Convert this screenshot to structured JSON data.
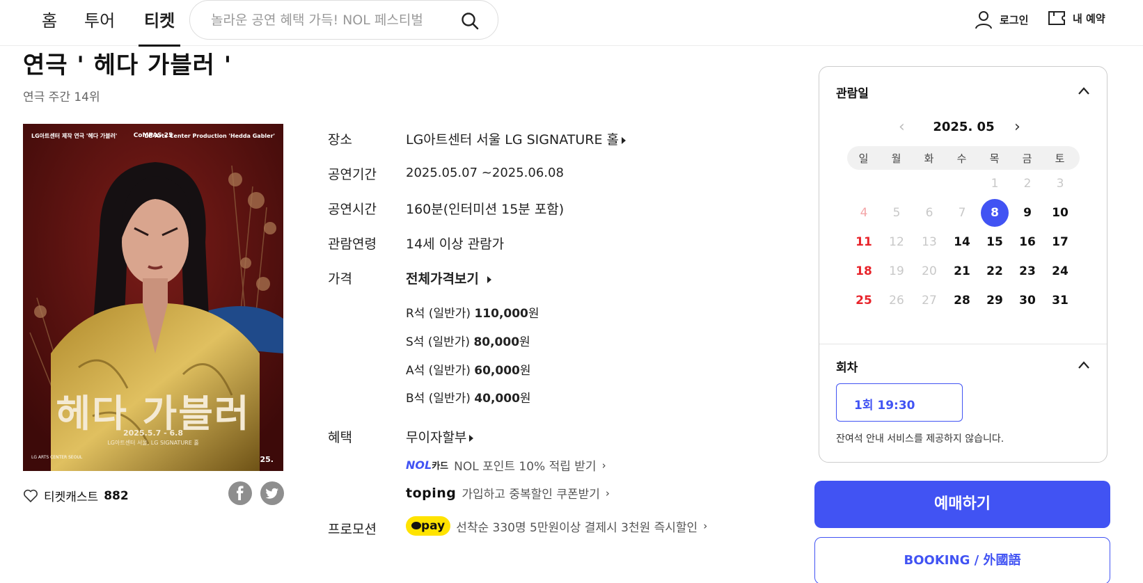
{
  "nav": {
    "tabs": [
      "홈",
      "투어",
      "티켓"
    ],
    "search_placeholder": "놀라운 공연 혜택 가득! NOL 페스티벌",
    "login": "로그인",
    "my_booking": "내 예약"
  },
  "show": {
    "title": "연극 ' 헤다 가블러 '",
    "rank": "연극 주간 14위"
  },
  "poster": {
    "top_left": "LG아트센터 제작\n연극 '헤다 가블러'",
    "top_center": "CoMPAS 25",
    "top_right": "LG Arts Center Production\n'Hedda Gabler'",
    "title": "헤다 가블러",
    "date": "2025.5.7 - 6.8",
    "venue": "LG아트센터 서울, LG SIGNATURE 홀",
    "logo": "LG ARTS CENTER SEOUL",
    "badge": "25."
  },
  "castbar": {
    "label": "티켓캐스트",
    "count": "882"
  },
  "info": {
    "venue_label": "장소",
    "venue": "LG아트센터 서울 LG SIGNATURE 홀",
    "period_label": "공연기간",
    "period": "2025.05.07 ~2025.06.08",
    "runtime_label": "공연시간",
    "runtime": "160분(인터미션 15분 포함)",
    "age_label": "관람연령",
    "age": "14세 이상 관람가",
    "price_label": "가격",
    "price_all": "전체가격보기",
    "prices": [
      {
        "seat": "R석 (일반가)",
        "amount": "110,000",
        "unit": "원"
      },
      {
        "seat": "S석 (일반가)",
        "amount": "80,000",
        "unit": "원"
      },
      {
        "seat": "A석 (일반가)",
        "amount": "60,000",
        "unit": "원"
      },
      {
        "seat": "B석 (일반가)",
        "amount": "40,000",
        "unit": "원"
      }
    ],
    "benefit_label": "혜택",
    "benefit": "무이자할부",
    "nol_brand": "NOL",
    "nol_card": "카드",
    "nol_text": "NOL 포인트 10% 적립 받기",
    "toping_brand": "toping",
    "toping_text": "가입하고 중복할인 쿠폰받기",
    "promo_label": "프로모션",
    "pay_brand": "pay",
    "promo_text": "선착순 330명 5만원이상 결제시 3천원 즉시할인"
  },
  "calendar": {
    "header": "관람일",
    "month": "2025. 05",
    "dow": [
      "일",
      "월",
      "화",
      "수",
      "목",
      "금",
      "토"
    ],
    "rows": [
      [
        "",
        "",
        "",
        "",
        "1",
        "2",
        "3"
      ],
      [
        "4",
        "5",
        "6",
        "7",
        "8",
        "9",
        "10"
      ],
      [
        "11",
        "12",
        "13",
        "14",
        "15",
        "16",
        "17"
      ],
      [
        "18",
        "19",
        "20",
        "21",
        "22",
        "23",
        "24"
      ],
      [
        "25",
        "26",
        "27",
        "28",
        "29",
        "30",
        "31"
      ]
    ],
    "past_days": [
      1,
      2,
      3,
      4,
      5,
      6,
      7,
      12,
      13,
      19,
      20,
      26,
      27
    ],
    "selected_day": 8
  },
  "session": {
    "header": "회차",
    "slot": "1회  19:30",
    "notice": "잔여석 안내 서비스를 제공하지 않습니다."
  },
  "buttons": {
    "book": "예매하기",
    "booking_foreign": "BOOKING / 外國語"
  },
  "colors": {
    "accent": "#4153f3",
    "sunday": "#e8242b",
    "kakao_yellow": "#ffe300"
  }
}
